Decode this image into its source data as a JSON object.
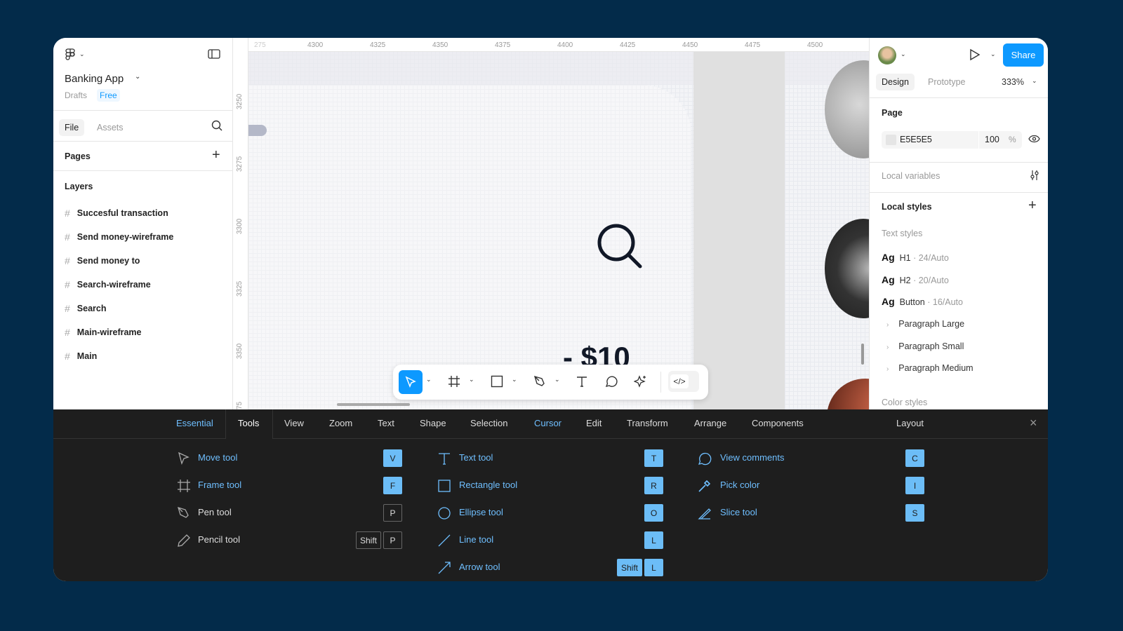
{
  "file": {
    "name": "Banking App",
    "location": "Drafts",
    "plan": "Free"
  },
  "left_panel": {
    "tabs": [
      "File",
      "Assets"
    ],
    "pages_label": "Pages",
    "layers_label": "Layers",
    "layers": [
      "Succesful transaction",
      "Send money-wireframe",
      "Send money to",
      "Search-wireframe",
      "Search",
      "Main-wireframe",
      "Main"
    ]
  },
  "ruler": {
    "top": [
      "275",
      "4300",
      "4325",
      "4350",
      "4375",
      "4400",
      "4425",
      "4450",
      "4475",
      "4500"
    ],
    "left": [
      "3250",
      "3275",
      "3300",
      "3325",
      "3350",
      "75"
    ]
  },
  "canvas": {
    "amount_text": "- $10"
  },
  "right_panel": {
    "share_label": "Share",
    "tabs": [
      "Design",
      "Prototype"
    ],
    "zoom": "333%",
    "page_label": "Page",
    "page_color": "E5E5E5",
    "page_opacity": "100",
    "percent": "%",
    "local_variables": "Local variables",
    "local_styles": "Local styles",
    "text_styles_label": "Text styles",
    "text_styles": [
      {
        "sample": "Ag",
        "name": "H1",
        "spec": " · 24/Auto"
      },
      {
        "sample": "Ag",
        "name": "H2",
        "spec": " · 20/Auto"
      },
      {
        "sample": "Ag",
        "name": "Button",
        "spec": " · 16/Auto"
      }
    ],
    "groups": [
      "Paragraph Large",
      "Paragraph Small",
      "Paragraph Medium"
    ],
    "color_styles_label": "Color styles"
  },
  "shortcuts": {
    "tabs": [
      "Essential",
      "Tools",
      "View",
      "Zoom",
      "Text",
      "Shape",
      "Selection",
      "Cursor",
      "Edit",
      "Transform",
      "Arrange",
      "Components"
    ],
    "layout_label": "Layout",
    "active_tab": "Tools",
    "col1": [
      {
        "label": "Move tool",
        "keys": [
          "V"
        ],
        "icon": "move-icon"
      },
      {
        "label": "Frame tool",
        "keys": [
          "F"
        ],
        "icon": "frame-icon"
      },
      {
        "label": "Pen tool",
        "keys": [
          "P"
        ],
        "icon": "pen-icon"
      },
      {
        "label": "Pencil tool",
        "keys": [
          "Shift",
          "P"
        ],
        "icon": "pencil-icon"
      }
    ],
    "col2": [
      {
        "label": "Text tool",
        "keys": [
          "T"
        ]
      },
      {
        "label": "Rectangle tool",
        "keys": [
          "R"
        ]
      },
      {
        "label": "Ellipse tool",
        "keys": [
          "O"
        ]
      },
      {
        "label": "Line tool",
        "keys": [
          "L"
        ]
      },
      {
        "label": "Arrow tool",
        "keys": [
          "Shift",
          "L"
        ]
      }
    ],
    "col3": [
      {
        "label": "View comments",
        "keys": [
          "C"
        ]
      },
      {
        "label": "Pick color",
        "keys": [
          "I"
        ]
      },
      {
        "label": "Slice tool",
        "keys": [
          "S"
        ]
      }
    ]
  },
  "colors": {
    "accent": "#0d99ff",
    "shortcut_blue": "#6cbdf7",
    "background": "#032b4a",
    "panel_dark": "#1e1e1e"
  }
}
